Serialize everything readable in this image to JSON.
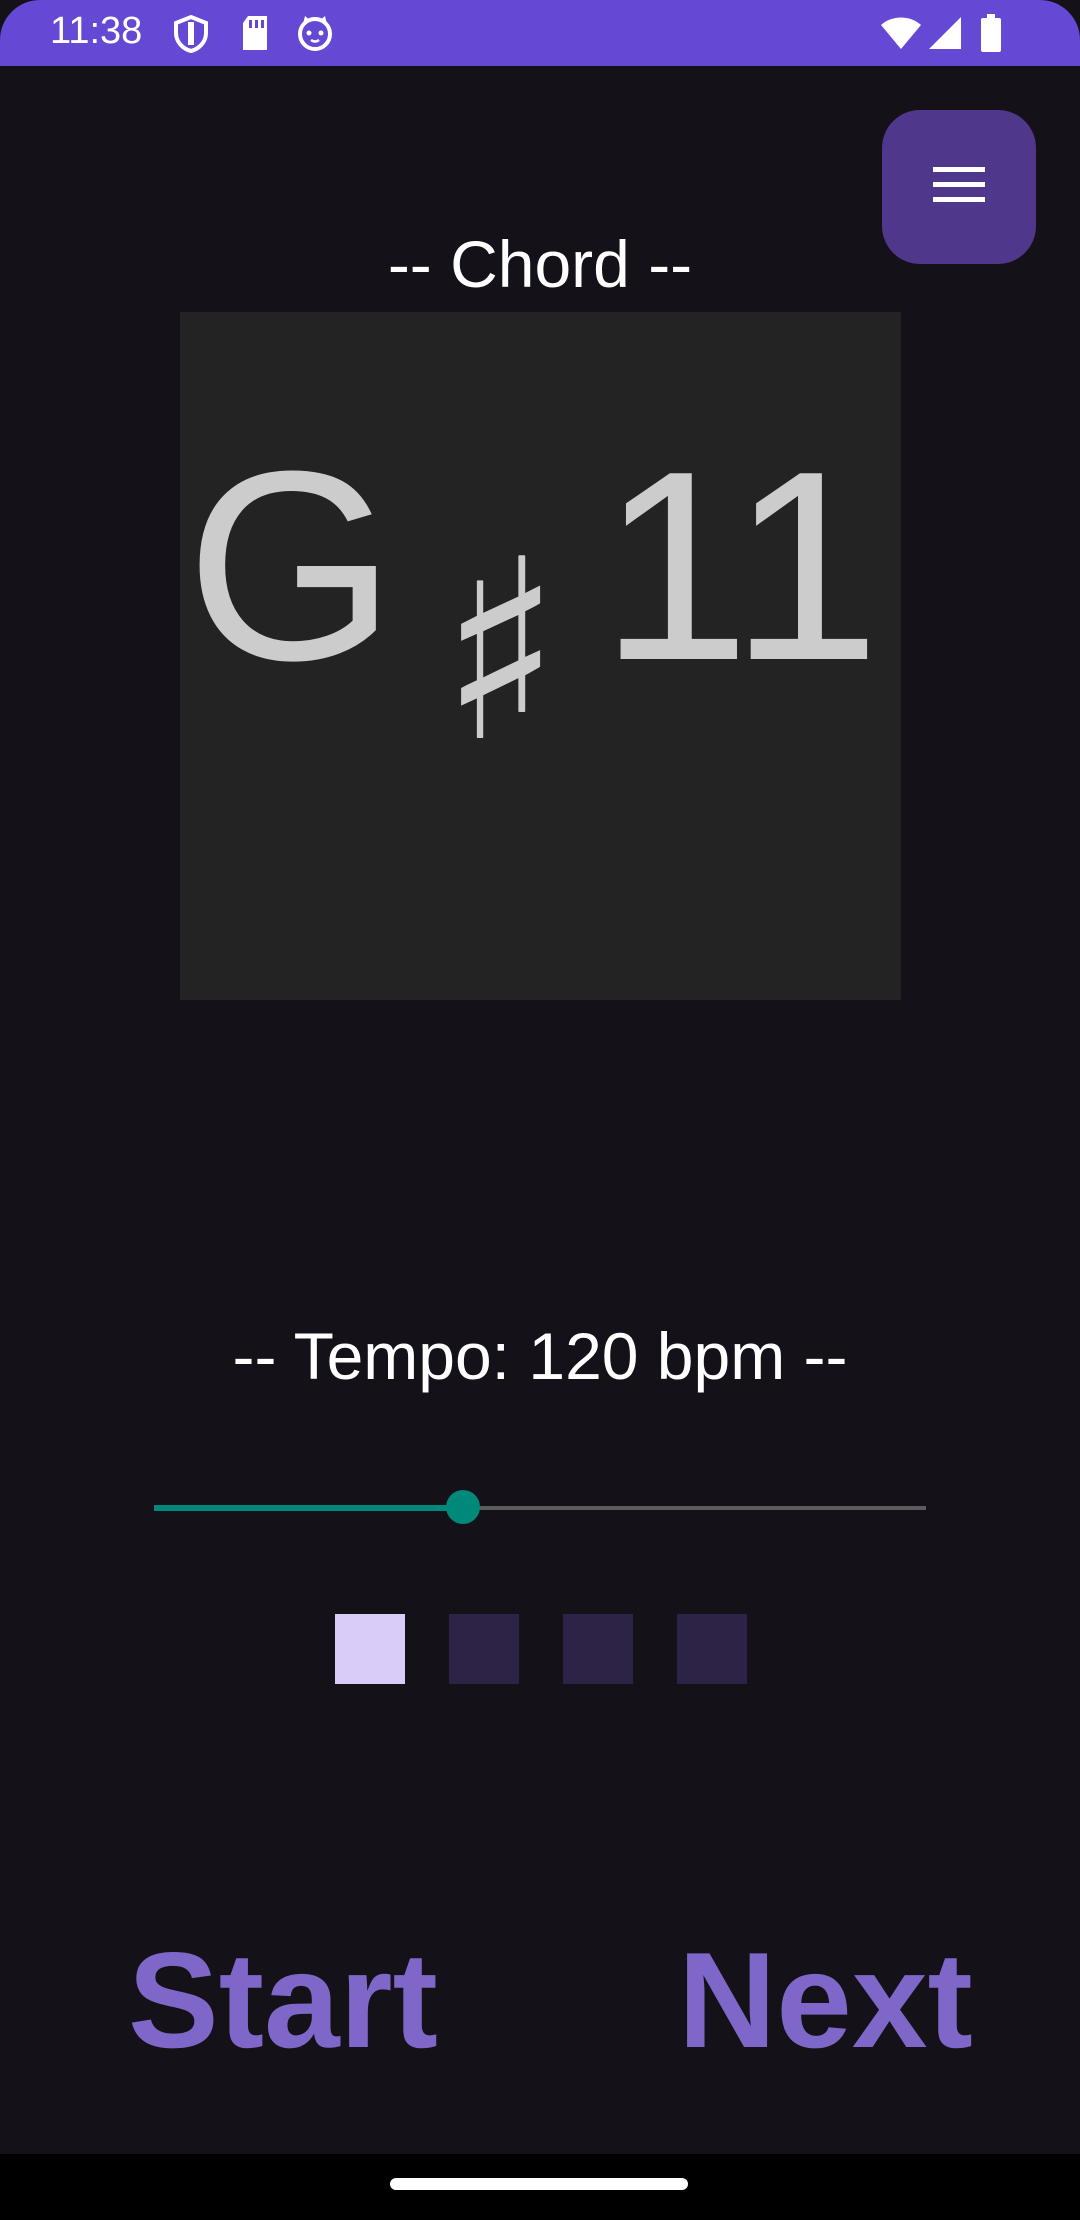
{
  "status_bar": {
    "time": "11:38",
    "left_icons": [
      "shield-icon",
      "sd-card-icon",
      "cat-face-icon"
    ],
    "right_icons": [
      "wifi-icon",
      "signal-icon",
      "battery-icon"
    ],
    "color": "#6548d4"
  },
  "menu": {
    "icon": "hamburger-menu-icon",
    "color": "#4f378b"
  },
  "chord": {
    "heading": "-- Chord --",
    "root": "G",
    "accidental": "♯",
    "extension": "11"
  },
  "tempo": {
    "heading": "-- Tempo: 120 bpm --",
    "slider_fraction": 0.4,
    "accent_color": "#00897b"
  },
  "beats": {
    "count": 4,
    "active_index": 0,
    "active_color": "#d9ccf8",
    "inactive_color": "#2c2347"
  },
  "buttons": {
    "start_label": "Start",
    "next_label": "Next",
    "color": "#7f67c9"
  }
}
